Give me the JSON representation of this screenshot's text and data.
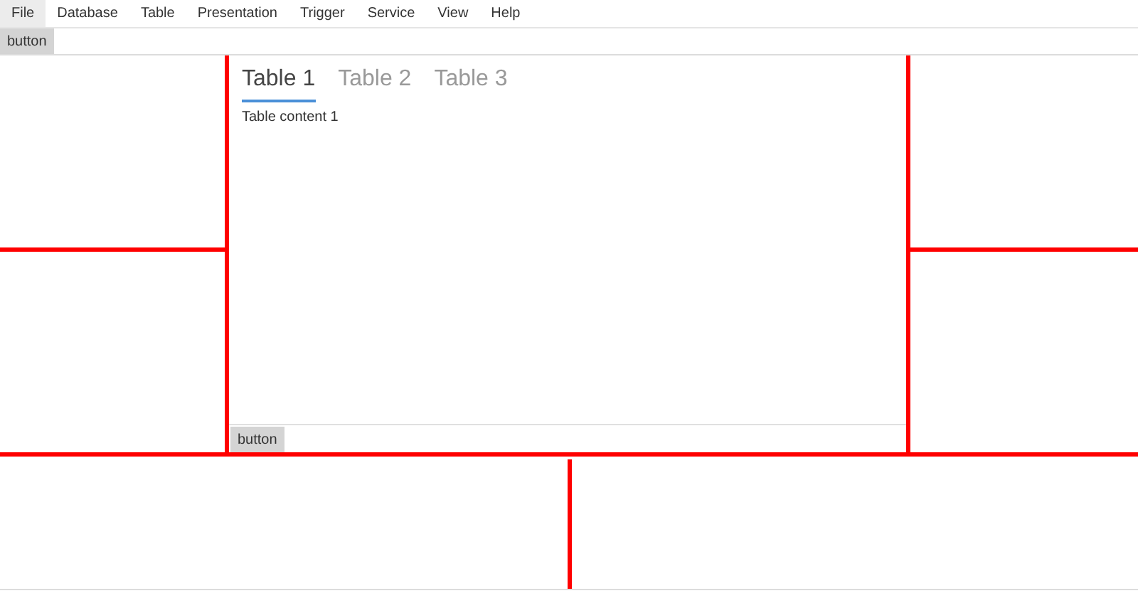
{
  "menu_bar": {
    "items": [
      {
        "label": "File",
        "selected": true
      },
      {
        "label": "Database",
        "selected": false
      },
      {
        "label": "Table",
        "selected": false
      },
      {
        "label": "Presentation",
        "selected": false
      },
      {
        "label": "Trigger",
        "selected": false
      },
      {
        "label": "Service",
        "selected": false
      },
      {
        "label": "View",
        "selected": false
      },
      {
        "label": "Help",
        "selected": false
      }
    ]
  },
  "toolbar": {
    "button": "button"
  },
  "center_panel": {
    "tabs": [
      {
        "label": "Table 1",
        "selected": true
      },
      {
        "label": "Table 2",
        "selected": false
      },
      {
        "label": "Table 3",
        "selected": false
      }
    ],
    "content": "Table content 1",
    "button": "button"
  }
}
